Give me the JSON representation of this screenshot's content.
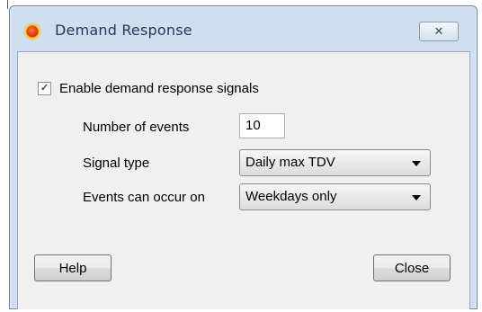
{
  "window": {
    "title": "Demand Response",
    "close_glyph": "✕"
  },
  "form": {
    "enable_checkbox": {
      "label": "Enable demand response signals",
      "checked": true,
      "check_glyph": "✓"
    },
    "number_of_events": {
      "label": "Number of events",
      "value": "10"
    },
    "signal_type": {
      "label": "Signal type",
      "selected": "Daily max TDV"
    },
    "events_can_occur_on": {
      "label": "Events can occur on",
      "selected": "Weekdays only"
    }
  },
  "buttons": {
    "help": "Help",
    "close": "Close"
  },
  "colors": {
    "title_text": "#1e395b",
    "frame": "#cfdff0",
    "client": "#f0f0f0",
    "check": "#21489c"
  },
  "icons": {
    "app_icon": "demand-response-sun-icon",
    "close": "close-icon",
    "dropdown": "chevron-down-icon"
  }
}
